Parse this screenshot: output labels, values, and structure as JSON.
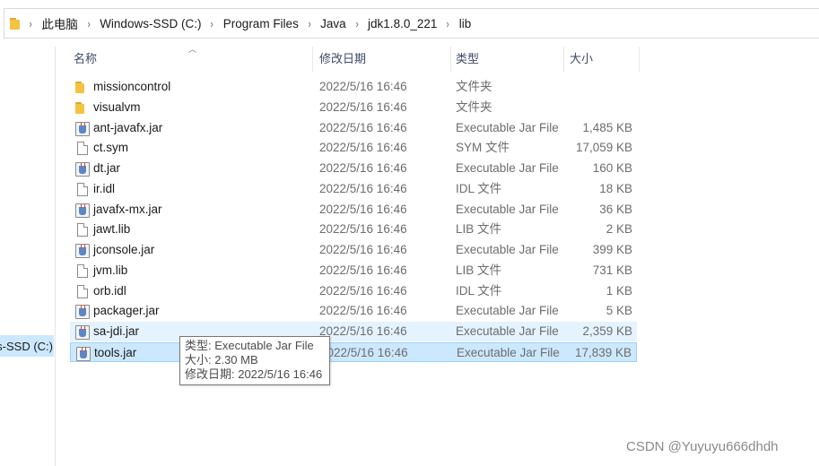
{
  "address_bar": {
    "crumbs": [
      "此电脑",
      "Windows-SSD (C:)",
      "Program Files",
      "Java",
      "jdk1.8.0_221",
      "lib"
    ],
    "separator": "›"
  },
  "nav": {
    "drive_label": "Windows-SSD (C:)",
    "next_item_label": ")"
  },
  "columns": {
    "name": "名称",
    "date": "修改日期",
    "type": "类型",
    "size": "大小"
  },
  "files": [
    {
      "name": "missioncontrol",
      "date": "2022/5/16 16:46",
      "type": "文件夹",
      "size": "",
      "icon": "folder-icon"
    },
    {
      "name": "visualvm",
      "date": "2022/5/16 16:46",
      "type": "文件夹",
      "size": "",
      "icon": "folder-icon"
    },
    {
      "name": "ant-javafx.jar",
      "date": "2022/5/16 16:46",
      "type": "Executable Jar File",
      "size": "1,485 KB",
      "icon": "jar-icon"
    },
    {
      "name": "ct.sym",
      "date": "2022/5/16 16:46",
      "type": "SYM 文件",
      "size": "17,059 KB",
      "icon": "file-icon"
    },
    {
      "name": "dt.jar",
      "date": "2022/5/16 16:46",
      "type": "Executable Jar File",
      "size": "160 KB",
      "icon": "jar-icon"
    },
    {
      "name": "ir.idl",
      "date": "2022/5/16 16:46",
      "type": "IDL 文件",
      "size": "18 KB",
      "icon": "file-icon"
    },
    {
      "name": "javafx-mx.jar",
      "date": "2022/5/16 16:46",
      "type": "Executable Jar File",
      "size": "36 KB",
      "icon": "jar-icon"
    },
    {
      "name": "jawt.lib",
      "date": "2022/5/16 16:46",
      "type": "LIB 文件",
      "size": "2 KB",
      "icon": "file-icon"
    },
    {
      "name": "jconsole.jar",
      "date": "2022/5/16 16:46",
      "type": "Executable Jar File",
      "size": "399 KB",
      "icon": "jar-icon"
    },
    {
      "name": "jvm.lib",
      "date": "2022/5/16 16:46",
      "type": "LIB 文件",
      "size": "731 KB",
      "icon": "file-icon"
    },
    {
      "name": "orb.idl",
      "date": "2022/5/16 16:46",
      "type": "IDL 文件",
      "size": "1 KB",
      "icon": "file-icon"
    },
    {
      "name": "packager.jar",
      "date": "2022/5/16 16:46",
      "type": "Executable Jar File",
      "size": "5 KB",
      "icon": "jar-icon"
    },
    {
      "name": "sa-jdi.jar",
      "date": "2022/5/16 16:46",
      "type": "Executable Jar File",
      "size": "2,359 KB",
      "icon": "jar-icon",
      "state": "hover"
    },
    {
      "name": "tools.jar",
      "date": "2022/5/16 16:46",
      "type": "Executable Jar File",
      "size": "17,839 KB",
      "icon": "jar-icon",
      "state": "selected"
    }
  ],
  "tooltip": {
    "line1": "类型: Executable Jar File",
    "line2": "大小: 2.30 MB",
    "line3": "修改日期: 2022/5/16 16:46"
  },
  "watermark": "CSDN @Yuyuyu666dhdh",
  "colors": {
    "selected_bg": "#cce8ff",
    "hover_bg": "#e5f3ff",
    "folder": "#f5c242",
    "header_text": "#3c4a66"
  }
}
